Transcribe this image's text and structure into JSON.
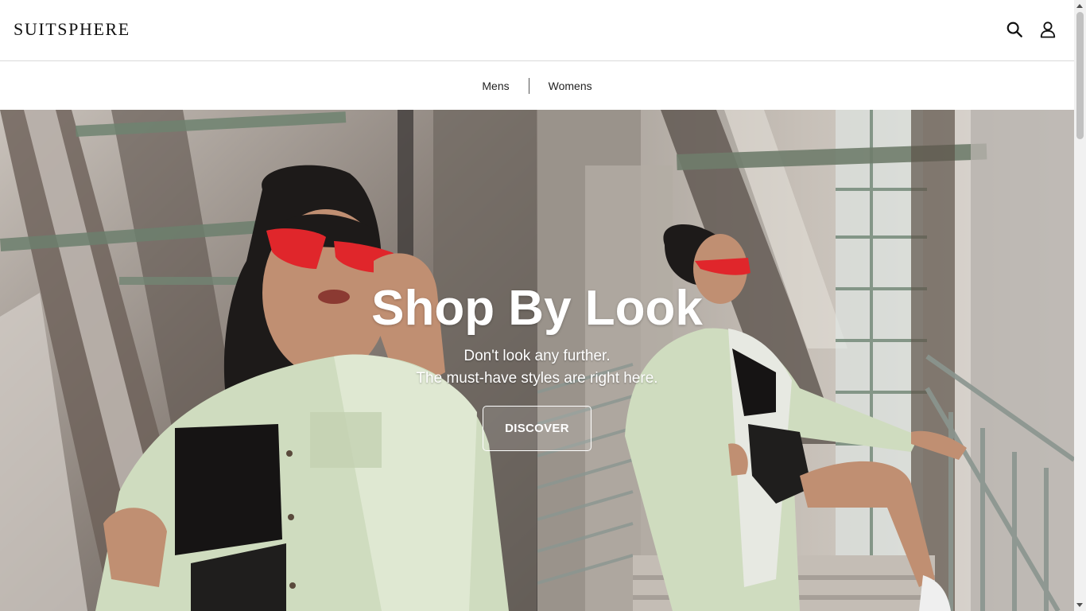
{
  "header": {
    "logo": "SUITSPHERE",
    "icons": [
      "search-icon",
      "user-icon"
    ]
  },
  "nav": {
    "items": [
      {
        "label": "Mens"
      },
      {
        "label": "Womens"
      }
    ]
  },
  "hero": {
    "title": "Shop By Look",
    "subtitle_line1": "Don't look any further.",
    "subtitle_line2": "The must-have styles are right here.",
    "cta_label": "DISCOVER"
  },
  "colors": {
    "text": "#111111",
    "border": "#d9d9d9",
    "jacket": "#cfdcbf",
    "glasses": "#e0262b",
    "concrete": "#8f8a85"
  }
}
